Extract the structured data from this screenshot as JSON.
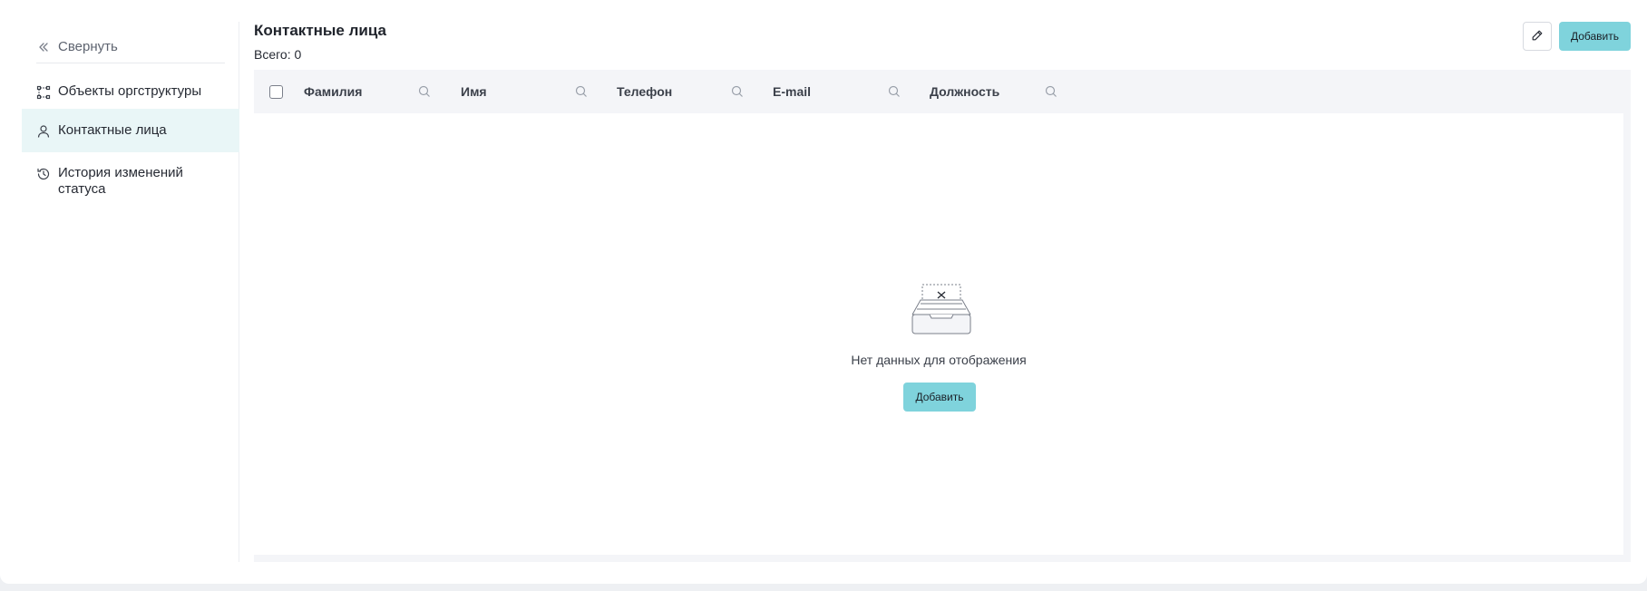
{
  "sidebar": {
    "collapse_label": "Свернуть",
    "items": [
      {
        "label": "Объекты оргструктуры",
        "icon": "org-structure-icon"
      },
      {
        "label": "Контактные лица",
        "icon": "person-icon",
        "active": true
      },
      {
        "label": "История изменений статуса",
        "icon": "history-icon"
      }
    ]
  },
  "main": {
    "title": "Контактные лица",
    "total": "Всего: 0",
    "edit_icon": "pencil-icon",
    "add_label": "Добавить"
  },
  "table": {
    "columns": [
      "Фамилия",
      "Имя",
      "Телефон",
      "E-mail",
      "Должность"
    ],
    "empty_text": "Нет данных для отображения",
    "empty_add_label": "Добавить"
  },
  "colors": {
    "accent": "#7fd3dc",
    "active_nav_bg": "#e9f6f7",
    "header_bg": "#f4f5f8"
  }
}
